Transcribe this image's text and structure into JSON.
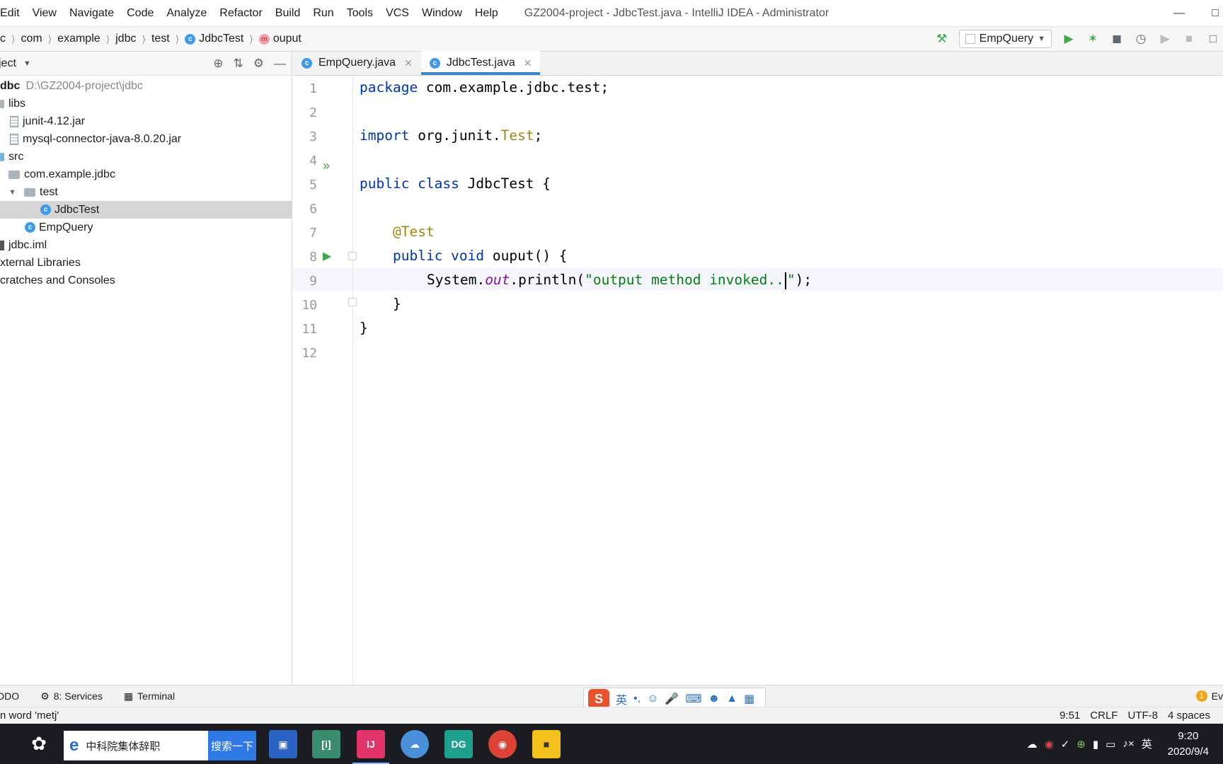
{
  "menu": [
    "Edit",
    "View",
    "Navigate",
    "Code",
    "Analyze",
    "Refactor",
    "Build",
    "Run",
    "Tools",
    "VCS",
    "Window",
    "Help"
  ],
  "window_title": "GZ2004-project - JdbcTest.java - IntelliJ IDEA - Administrator",
  "breadcrumb": {
    "first": "c",
    "items": [
      "com",
      "example",
      "jdbc",
      "test",
      "JdbcTest",
      "ouput"
    ]
  },
  "run_config": "EmpQuery",
  "project_panel": {
    "title": "ject",
    "tree": [
      {
        "label": "dbc",
        "path": "D:\\GZ2004-project\\jdbc"
      },
      {
        "label": "libs"
      },
      {
        "label": "junit-4.12.jar"
      },
      {
        "label": "mysql-connector-java-8.0.20.jar"
      },
      {
        "label": "src"
      },
      {
        "label": "com.example.jdbc"
      },
      {
        "label": "test"
      },
      {
        "label": "JdbcTest"
      },
      {
        "label": "EmpQuery"
      },
      {
        "label": "jdbc.iml"
      },
      {
        "label": "xternal Libraries"
      },
      {
        "label": "cratches and Consoles"
      }
    ]
  },
  "editor": {
    "tabs": [
      "EmpQuery.java",
      "JdbcTest.java"
    ],
    "line_numbers": [
      "1",
      "2",
      "3",
      "4",
      "5",
      "6",
      "7",
      "8",
      "9",
      "10",
      "11",
      "12"
    ],
    "code": {
      "l1_kw": "package",
      "l1_rest": " com.example.jdbc.test;",
      "l3_kw": "import",
      "l3_rest": " org.junit.",
      "l3_cls": "Test",
      "l3_end": ";",
      "l5_kw": "public class",
      "l5_rest": " JdbcTest {",
      "l7_ann": "@Test",
      "l8_kw": "public void",
      "l8_rest": " ouput() {",
      "l9_a": "System.",
      "l9_field": "out",
      "l9_b": ".println(",
      "l9_str1": "\"output method invoked..",
      "l9_str2": "\"",
      "l9_end": ");",
      "l10": "}",
      "l11": "}"
    }
  },
  "tool_windows": [
    "DDO",
    "8: Services",
    "Terminal"
  ],
  "event_log": {
    "badge": "1",
    "label": "Ev"
  },
  "status": {
    "message": "n word 'metj'",
    "position": "9:51",
    "line_sep": "CRLF",
    "encoding": "UTF-8",
    "indent": "4 spaces"
  },
  "ime": {
    "lang": "英",
    "punct": "•,"
  },
  "taskbar": {
    "search_text": "中科院集体辞职",
    "search_button": "搜索一下",
    "lang": "英",
    "time": "9:20",
    "date": "2020/9/4"
  },
  "colors": {
    "accent": "#4083c9",
    "keyword": "#0033b3",
    "string": "#067d17",
    "annotation": "#9e880d",
    "field": "#871094"
  }
}
